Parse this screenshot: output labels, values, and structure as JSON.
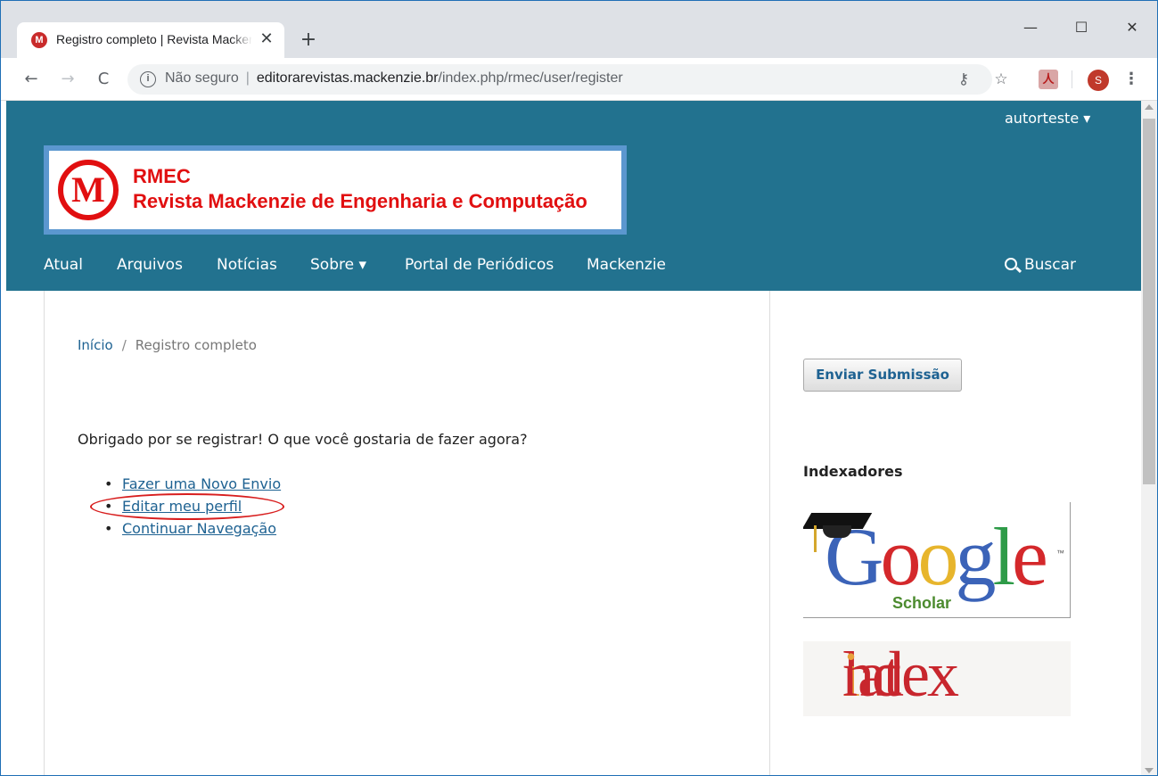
{
  "browser": {
    "tab_title": "Registro completo | Revista Mackenzie de Engenharia e Computação",
    "tab_favicon": "M",
    "tab_close": "✕",
    "new_tab": "+",
    "window_controls": {
      "minimize": "—",
      "maximize": "☐",
      "close": "✕"
    },
    "back": "←",
    "forward": "→",
    "reload": "C",
    "security_label": "Não seguro",
    "url_host": "editorarevistas.mackenzie.br",
    "url_path": "/index.php/rmec/user/register",
    "key_icon": "⚷",
    "star_icon": "☆",
    "extension_label": "人",
    "profile_initial": "S",
    "menu_icon": "⋮"
  },
  "header": {
    "user_menu": "autorteste ▾",
    "logo_mark": "M",
    "logo_line1": "RMEC",
    "logo_line2": "Revista Mackenzie de Engenharia e Computação"
  },
  "nav": {
    "items": [
      "Atual",
      "Arquivos",
      "Notícias",
      "Sobre ▾",
      "Portal de Periódicos",
      "Mackenzie"
    ],
    "search_label": "Buscar"
  },
  "breadcrumb": {
    "home": "Início",
    "separator": "/",
    "current": "Registro completo"
  },
  "main": {
    "message": "Obrigado por se registrar! O que você gostaria de fazer agora?",
    "actions": [
      "Fazer uma Novo Envio",
      "Editar meu perfil",
      "Continuar Navegação"
    ]
  },
  "sidebar": {
    "submit_button": "Enviar Submissão",
    "indexers_title": "Indexadores",
    "scholar_logo": {
      "g1": "G",
      "o1": "o",
      "o2": "o",
      "g2": "g",
      "l": "l",
      "e": "e",
      "tm": "™",
      "word": "Scholar"
    },
    "latindex_logo": {
      "part1": "lat",
      "i": "i",
      "part2": "ndex"
    }
  },
  "colors": {
    "header": "#22728f",
    "link": "#1e6292",
    "logo_red": "#e10f10",
    "highlight": "#d81e1e"
  }
}
